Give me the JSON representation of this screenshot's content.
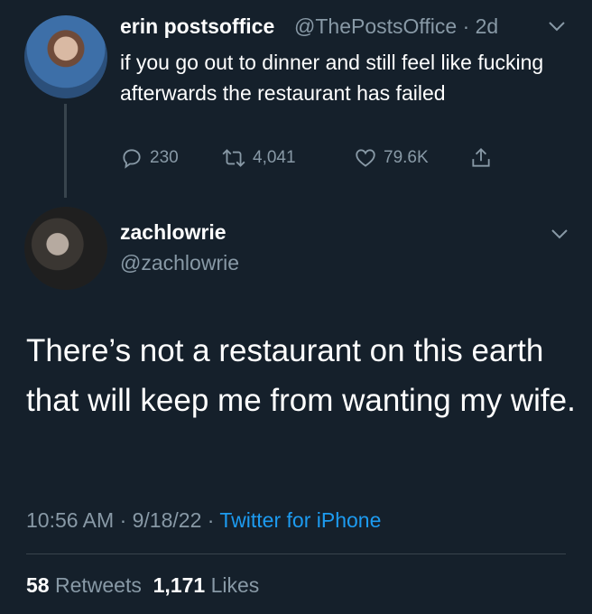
{
  "quoted_tweet": {
    "display_name": "erin postsoffice",
    "handle": "@ThePostsOffice",
    "time_ago": "· 2d",
    "text": "if you go out to dinner and still feel like fucking afterwards the restaurant has failed",
    "replies": "230",
    "retweets": "4,041",
    "likes": "79.6K"
  },
  "tweet": {
    "display_name": "zachlowrie",
    "handle": "@zachlowrie",
    "text": "There’s not a restaurant on this earth that will keep me from wanting my wife.",
    "time": "10:56 AM · 9/18/22 ·",
    "source": "Twitter for iPhone",
    "retweets_count": "58",
    "retweets_label": "Retweets",
    "likes_count": "1,171",
    "likes_label": "Likes"
  },
  "icons": [
    "reply-icon",
    "retweet-icon",
    "like-icon",
    "share-icon",
    "chevron-down-icon"
  ],
  "colors": {
    "background": "#15202b",
    "secondary_text": "#8899a6",
    "link": "#1d9bf0",
    "divider": "#38444d"
  }
}
